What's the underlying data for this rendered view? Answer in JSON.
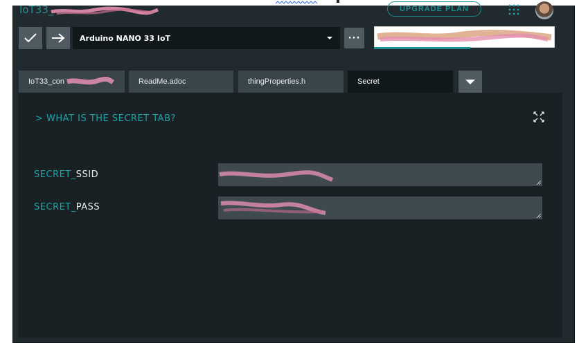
{
  "header": {
    "project_name": "IoT33_",
    "upgrade_label": "UPGRADE PLAN"
  },
  "toolbar": {
    "board_name": "Arduino NANO 33 IoT",
    "more_label": "···",
    "verify_icon": "checkmark-icon",
    "upload_icon": "arrow-right-icon"
  },
  "tabs": [
    {
      "label": "IoT33_con"
    },
    {
      "label": "ReadMe.adoc"
    },
    {
      "label": "thingProperties.h"
    },
    {
      "label": "Secret"
    }
  ],
  "secret_tab": {
    "help_link": "> WHAT IS THE SECRET TAB?",
    "fields": [
      {
        "prefix": "SECRET_",
        "name": "SSID",
        "value": ""
      },
      {
        "prefix": "SECRET_",
        "name": "PASS",
        "value": ""
      }
    ]
  },
  "colors": {
    "accent": "#1ea3a6",
    "panel_bg": "#192124",
    "toolbar_bg": "#202a2f",
    "redaction": "#e58fb0"
  }
}
